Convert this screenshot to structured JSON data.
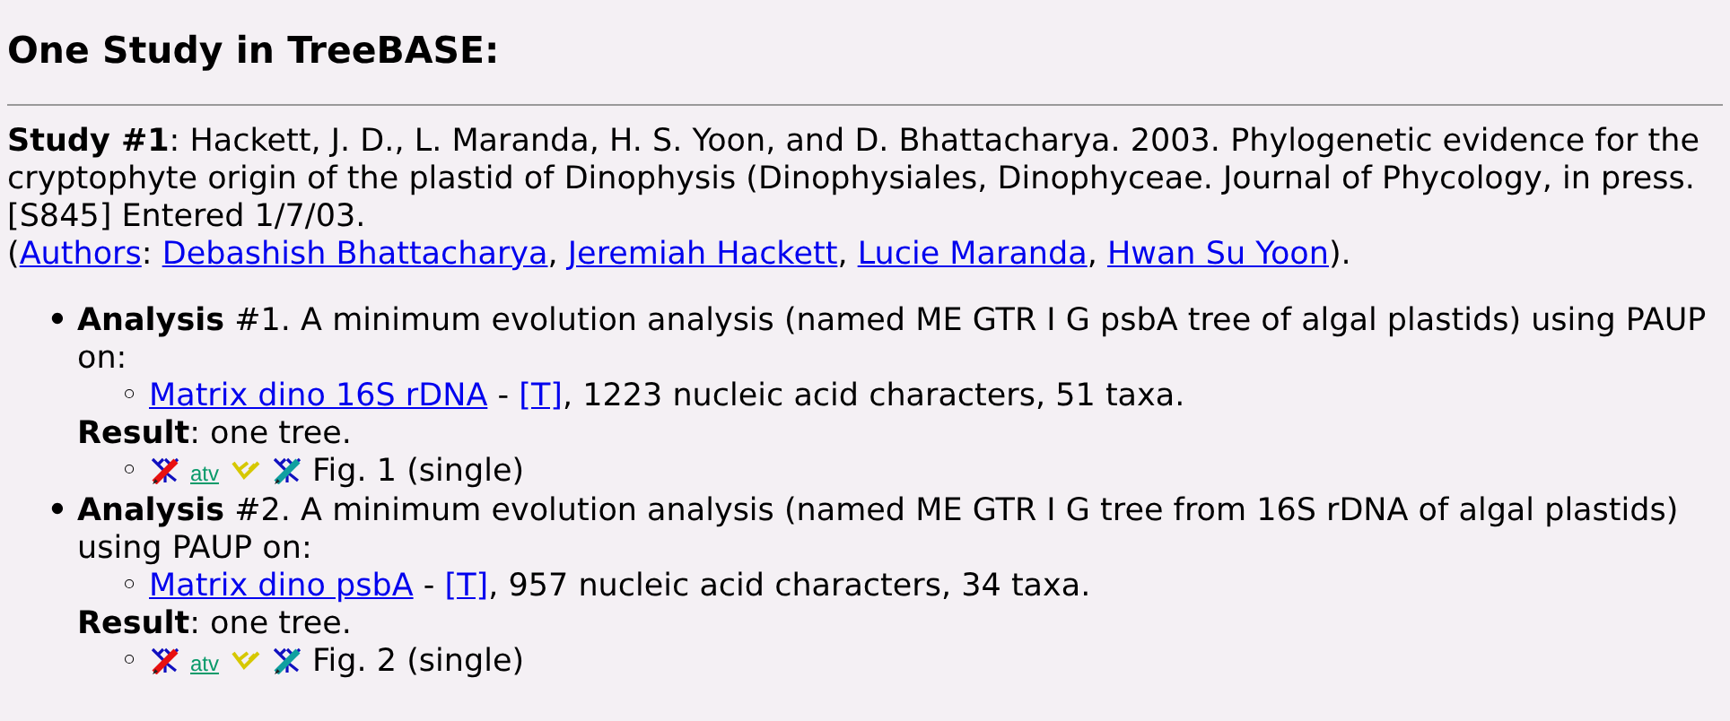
{
  "title": "One Study in TreeBASE:",
  "study": {
    "label": "Study #1",
    "citation": ": Hackett, J. D., L. Maranda, H. S. Yoon, and D. Bhattacharya. 2003. Phylogenetic evidence for the cryptophyte origin of the plastid of Dinophysis (Dinophysiales, Dinophyceae. Journal of Phycology, in press. [S845] Entered 1/7/03.",
    "authors_line": [
      {
        "kind": "text",
        "text": "("
      },
      {
        "kind": "link",
        "text": "Authors"
      },
      {
        "kind": "text",
        "text": ": "
      },
      {
        "kind": "link",
        "text": "Debashish Bhattacharya"
      },
      {
        "kind": "text",
        "text": ", "
      },
      {
        "kind": "link",
        "text": "Jeremiah Hackett"
      },
      {
        "kind": "text",
        "text": ", "
      },
      {
        "kind": "link",
        "text": "Lucie Maranda"
      },
      {
        "kind": "text",
        "text": ", "
      },
      {
        "kind": "link",
        "text": "Hwan Su Yoon"
      },
      {
        "kind": "text",
        "text": ")."
      }
    ]
  },
  "analyses": [
    {
      "marker": "•",
      "label": "Analysis",
      "text": " #1. A minimum evolution analysis (named ME GTR I G psbA tree of algal plastids) using PAUP on:",
      "matrix": {
        "marker": "◦",
        "link": "Matrix dino 16S rDNA",
        "sep": " - ",
        "t_link": "[T]",
        "rest": ", 1223 nucleic acid characters, 51 taxa."
      },
      "result_label": "Result",
      "result_text": ": one tree.",
      "figure": {
        "marker": "◦",
        "atv": "atv",
        "text": "Fig. 1 (single)"
      }
    },
    {
      "marker": "•",
      "label": "Analysis",
      "text": " #2. A minimum evolution analysis (named ME GTR I G tree from 16S rDNA of algal plastids) using PAUP on:",
      "matrix": {
        "marker": "◦",
        "link": "Matrix dino psbA",
        "sep": " - ",
        "t_link": "[T]",
        "rest": ", 957 nucleic acid characters, 34 taxa."
      },
      "result_label": "Result",
      "result_text": ": one tree.",
      "figure": {
        "marker": "◦",
        "atv": "atv",
        "text": "Fig. 2 (single)"
      }
    }
  ]
}
